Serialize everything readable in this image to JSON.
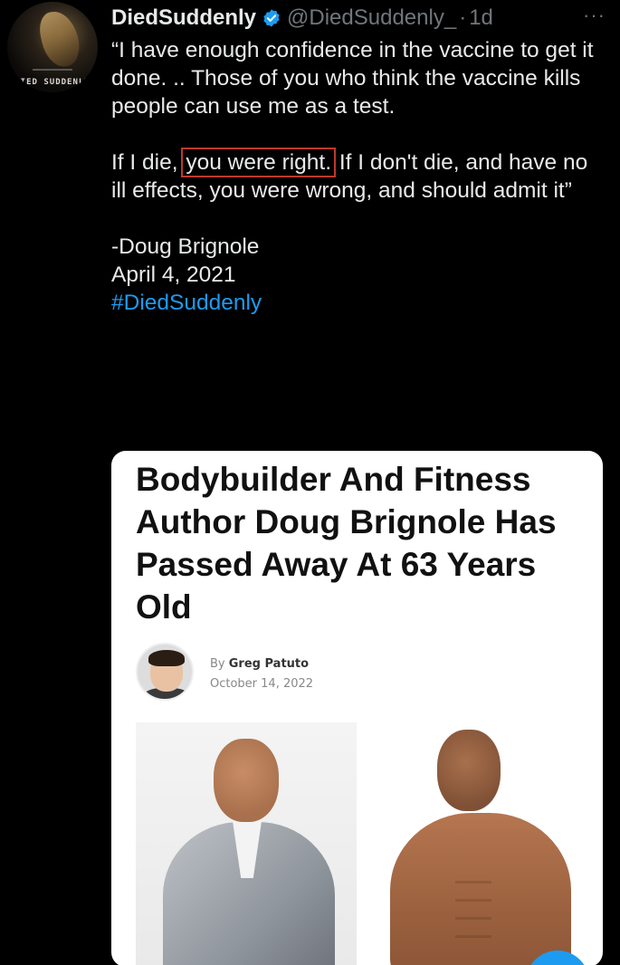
{
  "avatar": {
    "text": "DIED SUDDENLY"
  },
  "header": {
    "display_name": "DiedSuddenly",
    "handle": "@DiedSuddenly_",
    "separator": "·",
    "time": "1d",
    "more": "···"
  },
  "tweet": {
    "line1": "“I have enough confidence in the vaccine to get it done. .. Those of you who think the vaccine kills people can use me as a test.",
    "line2_pre": "If I die,",
    "line2_highlight": "you were right.",
    "line2_post": "If I don't die, and have no ill effects, you were wrong, and should admit it”",
    "attribution": "-Doug Brignole",
    "date": "April 4, 2021",
    "hashtag": "#DiedSuddenly"
  },
  "card": {
    "headline": "Bodybuilder And Fitness Author Doug Brignole Has Passed Away At 63 Years Old",
    "by": "By",
    "author": "Greg Patuto",
    "date": "October 14, 2022"
  },
  "colors": {
    "background": "#000000",
    "text": "#e7e9ea",
    "muted": "#71767b",
    "link": "#1d9bf0",
    "highlight_border": "#c0392b"
  }
}
